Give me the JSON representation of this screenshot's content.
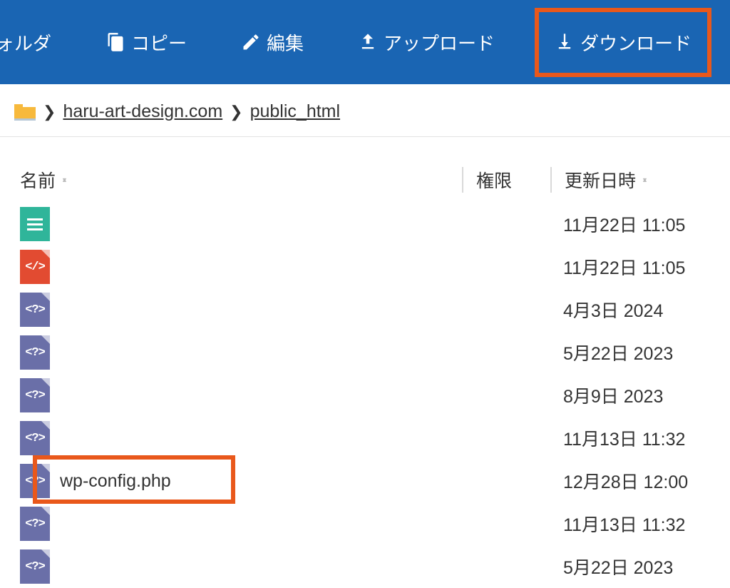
{
  "toolbar": {
    "folder": "フォルダ",
    "copy": "コピー",
    "edit": "編集",
    "upload": "アップロード",
    "download": "ダウンロード"
  },
  "breadcrumb": {
    "domain": "haru-art-design.com",
    "folder": "public_html"
  },
  "columns": {
    "name": "名前",
    "perm": "権限",
    "date": "更新日時"
  },
  "files": [
    {
      "type": "text",
      "name": "",
      "date": "11月22日 11:05"
    },
    {
      "type": "html",
      "name": "",
      "date": "11月22日 11:05"
    },
    {
      "type": "php",
      "name": "",
      "date": "4月3日 2024"
    },
    {
      "type": "php",
      "name": "",
      "date": "5月22日 2023"
    },
    {
      "type": "php",
      "name": "",
      "date": "8月9日 2023"
    },
    {
      "type": "php",
      "name": "",
      "date": "11月13日 11:32"
    },
    {
      "type": "php",
      "name": "wp-config.php",
      "date": "12月28日 12:00",
      "highlight": true
    },
    {
      "type": "php",
      "name": "",
      "date": "11月13日 11:32"
    },
    {
      "type": "php",
      "name": "",
      "date": "5月22日 2023"
    }
  ]
}
